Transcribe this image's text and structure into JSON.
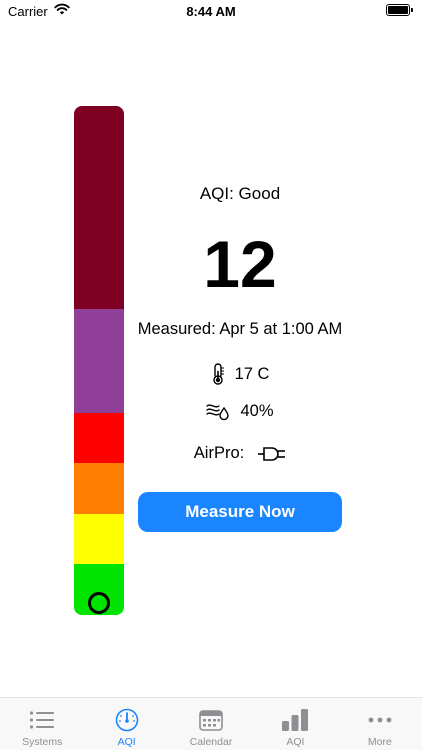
{
  "status_bar": {
    "carrier": "Carrier",
    "time": "8:44 AM"
  },
  "aqi": {
    "label": "AQI: Good",
    "value": "12",
    "measured": "Measured: Apr 5 at 1:00 AM",
    "scale_colors": {
      "hazardous": "#7e0023",
      "very_unhealthy": "#8f3f97",
      "unhealthy": "#ff0000",
      "unhealthy_sensitive": "#ff7e00",
      "moderate": "#ffff00",
      "good": "#00e400"
    }
  },
  "readings": {
    "temperature": "17 C",
    "humidity": "40%",
    "airpro_label": "AirPro:",
    "temperature_icon": "thermometer-icon",
    "humidity_icon": "humidity-icon",
    "airpro_icon": "plug-icon"
  },
  "button": {
    "measure_label": "Measure Now",
    "color": "#1a85ff"
  },
  "tab_bar": {
    "active_color": "#1a85ff",
    "inactive_color": "#8e8e93",
    "tabs": [
      {
        "label": "Systems",
        "icon": "list-icon"
      },
      {
        "label": "AQI",
        "icon": "gauge-icon"
      },
      {
        "label": "Calendar",
        "icon": "calendar-icon"
      },
      {
        "label": "AQI",
        "icon": "bar-chart-icon"
      },
      {
        "label": "More",
        "icon": "more-icon"
      }
    ]
  }
}
